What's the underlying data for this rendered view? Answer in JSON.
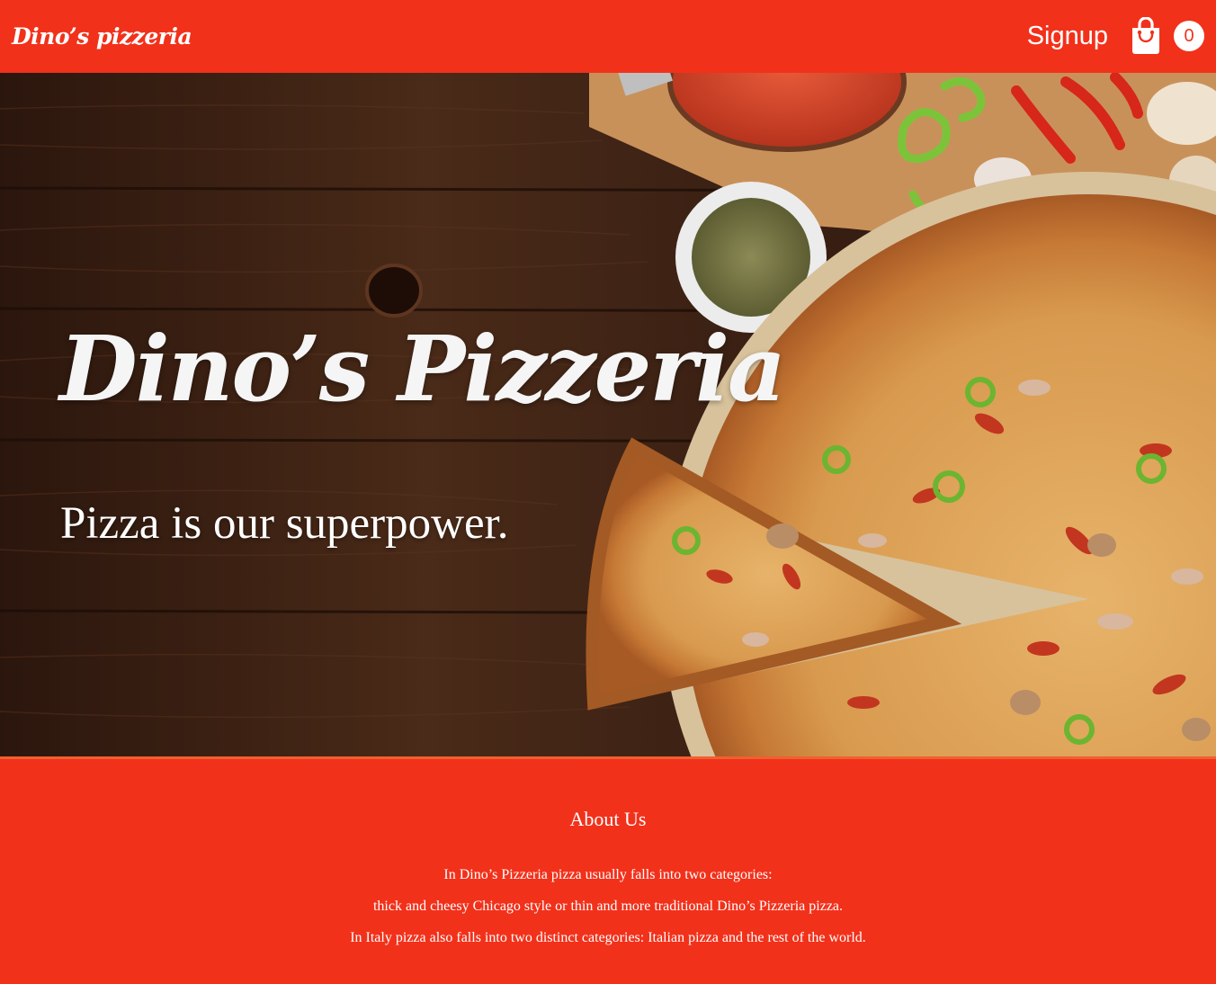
{
  "header": {
    "brand": "Dino’s pizzeria",
    "signup_label": "Signup",
    "cart_icon": "shopping-bag-icon",
    "cart_count": "0"
  },
  "hero": {
    "title": "Dino’s Pizzeria",
    "tagline": "Pizza is our superpower."
  },
  "about": {
    "heading": "About Us",
    "paragraphs": [
      "In Dino’s Pizzeria pizza usually falls into two categories:",
      "thick and cheesy Chicago style or thin and more traditional Dino’s Pizzeria pizza.",
      "In Italy pizza also falls into two distinct categories: Italian pizza and the rest of the world."
    ]
  },
  "colors": {
    "brand_red": "#f2311b",
    "wood": "#3a2014",
    "text": "#ffffff"
  }
}
